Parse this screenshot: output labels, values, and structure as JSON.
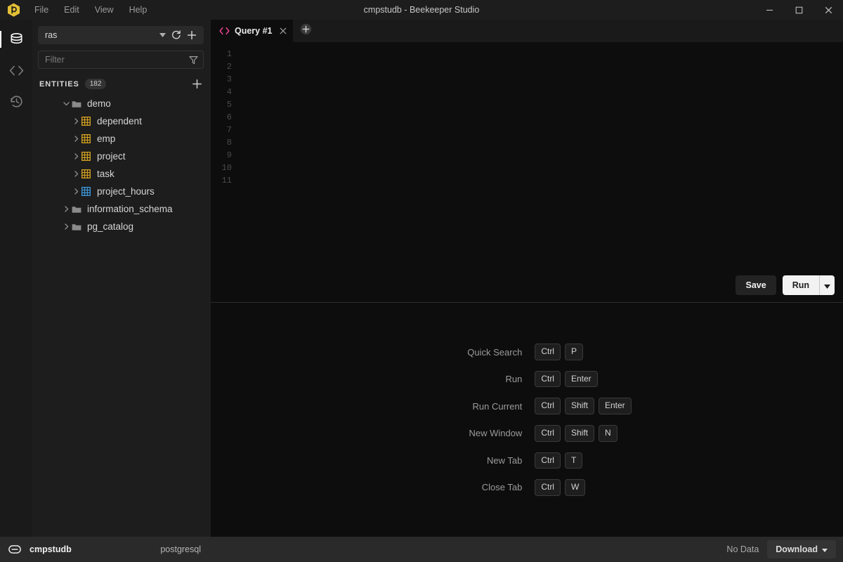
{
  "window": {
    "title": "cmpstudb - Beekeeper Studio",
    "logo_icon": "beekeeper-logo-icon",
    "minimize_icon": "minimize-icon",
    "maximize_icon": "maximize-icon",
    "close_icon": "close-icon"
  },
  "menu": {
    "items": [
      {
        "label": "File"
      },
      {
        "label": "Edit"
      },
      {
        "label": "View"
      },
      {
        "label": "Help"
      }
    ]
  },
  "rail": {
    "items": [
      {
        "name": "database-icon",
        "active": true
      },
      {
        "name": "code-icon",
        "active": false
      },
      {
        "name": "history-icon",
        "active": false
      }
    ]
  },
  "sidebar": {
    "database_selector": {
      "value": "ras",
      "caret_icon": "chevron-down-icon",
      "refresh_icon": "refresh-icon",
      "add_icon": "plus-icon"
    },
    "filter": {
      "placeholder": "Filter",
      "value": "",
      "icon": "filter-icon"
    },
    "entities": {
      "label": "ENTITIES",
      "count": "182",
      "add_icon": "plus-icon"
    },
    "tree": [
      {
        "label": "demo",
        "type": "schema",
        "level": 0,
        "expanded": true,
        "icon": "folder-icon"
      },
      {
        "label": "dependent",
        "type": "table",
        "level": 1,
        "expanded": false,
        "icon": "table-icon"
      },
      {
        "label": "emp",
        "type": "table",
        "level": 1,
        "expanded": false,
        "icon": "table-icon"
      },
      {
        "label": "project",
        "type": "table",
        "level": 1,
        "expanded": false,
        "icon": "table-icon"
      },
      {
        "label": "task",
        "type": "table",
        "level": 1,
        "expanded": false,
        "icon": "table-icon"
      },
      {
        "label": "project_hours",
        "type": "view",
        "level": 1,
        "expanded": false,
        "icon": "view-icon"
      },
      {
        "label": "information_schema",
        "type": "schema",
        "level": 0,
        "expanded": false,
        "icon": "folder-icon"
      },
      {
        "label": "pg_catalog",
        "type": "schema",
        "level": 0,
        "expanded": false,
        "icon": "folder-icon"
      }
    ]
  },
  "tabs": {
    "items": [
      {
        "label": "Query #1",
        "icon": "code-icon",
        "active": true,
        "close_icon": "close-icon"
      }
    ],
    "add_icon": "plus-circle-icon"
  },
  "editor": {
    "line_numbers": [
      "1",
      "2",
      "3",
      "4",
      "5",
      "6",
      "7",
      "8",
      "9",
      "10",
      "11"
    ],
    "content": "",
    "save_label": "Save",
    "run_label": "Run",
    "run_caret_icon": "chevron-down-icon"
  },
  "shortcuts": [
    {
      "label": "Quick Search",
      "keys": [
        "Ctrl",
        "P"
      ]
    },
    {
      "label": "Run",
      "keys": [
        "Ctrl",
        "Enter"
      ]
    },
    {
      "label": "Run Current",
      "keys": [
        "Ctrl",
        "Shift",
        "Enter"
      ]
    },
    {
      "label": "New Window",
      "keys": [
        "Ctrl",
        "Shift",
        "N"
      ]
    },
    {
      "label": "New Tab",
      "keys": [
        "Ctrl",
        "T"
      ]
    },
    {
      "label": "Close Tab",
      "keys": [
        "Ctrl",
        "W"
      ]
    }
  ],
  "statusbar": {
    "connection_icon": "link-icon",
    "connection_name": "cmpstudb",
    "engine": "postgresql",
    "result_status": "No Data",
    "download_label": "Download",
    "download_caret_icon": "chevron-down-icon"
  },
  "colors": {
    "accent_yellow": "#e5c035",
    "tab_icon_pink": "#e84393",
    "table_icon": "#d9a520",
    "view_icon": "#3d9ae0",
    "titlebar_bg": "#1d1d1d",
    "sidebar_bg": "#1d1d1d",
    "editor_bg": "#0d0d0d",
    "statusbar_bg": "#2a2a2a"
  }
}
